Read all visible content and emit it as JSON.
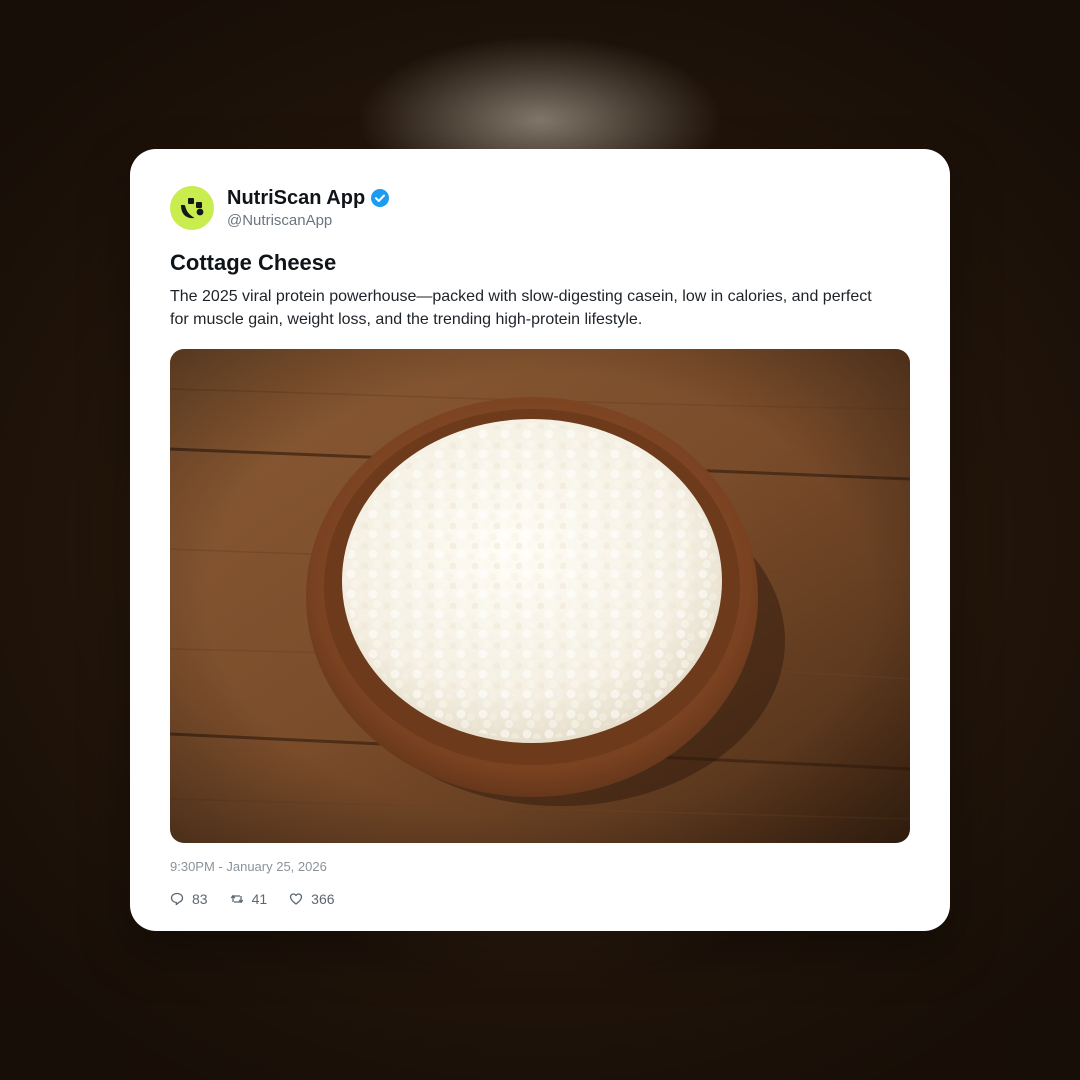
{
  "post": {
    "author": {
      "display_name": "NutriScan App",
      "handle": "@NutriscanApp",
      "verified": true,
      "avatar_icon": "leaf-logo-icon",
      "avatar_color": "#c9ec4f"
    },
    "title": "Cottage Cheese",
    "text": "The 2025 viral protein powerhouse—packed with slow-digesting casein, low in calories, and perfect for muscle gain, weight loss, and the trending high-protein lifestyle.",
    "image_subject": "cottage-cheese-in-wooden-bowl",
    "timestamp": "9:30PM - January 25, 2026",
    "stats": {
      "replies": "83",
      "reposts": "41",
      "likes": "366"
    }
  },
  "colors": {
    "verified_badge": "#1d9bf0",
    "text_primary": "#0f1419",
    "text_secondary": "#6b7680"
  }
}
